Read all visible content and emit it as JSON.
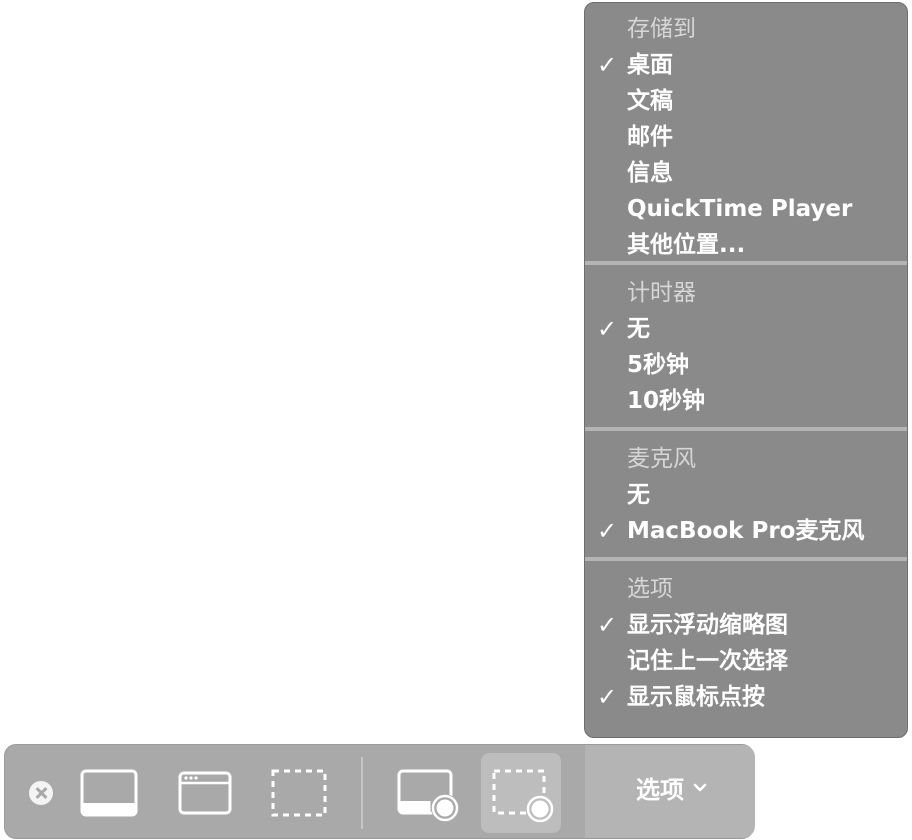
{
  "menu": {
    "sections": [
      {
        "header": "存储到",
        "items": [
          {
            "label": "桌面",
            "checked": true
          },
          {
            "label": "文稿",
            "checked": false
          },
          {
            "label": "邮件",
            "checked": false
          },
          {
            "label": "信息",
            "checked": false
          },
          {
            "label": "QuickTime Player",
            "checked": false
          },
          {
            "label": "其他位置...",
            "checked": false
          }
        ]
      },
      {
        "header": "计时器",
        "items": [
          {
            "label": "无",
            "checked": true
          },
          {
            "label": "5秒钟",
            "checked": false
          },
          {
            "label": "10秒钟",
            "checked": false
          }
        ]
      },
      {
        "header": "麦克风",
        "items": [
          {
            "label": "无",
            "checked": false
          },
          {
            "label": "MacBook Pro麦克风",
            "checked": true
          }
        ]
      },
      {
        "header": "选项",
        "items": [
          {
            "label": "显示浮动缩略图",
            "checked": true
          },
          {
            "label": "记住上一次选择",
            "checked": false
          },
          {
            "label": "显示鼠标点按",
            "checked": true
          }
        ]
      }
    ],
    "check_glyph": "✓"
  },
  "toolbar": {
    "options_label": "选项",
    "buttons": [
      {
        "icon": "capture-entire-screen-icon"
      },
      {
        "icon": "capture-window-icon"
      },
      {
        "icon": "capture-selection-icon"
      },
      {
        "icon": "record-entire-screen-icon"
      },
      {
        "icon": "record-selection-icon",
        "selected": true
      }
    ]
  },
  "colors": {
    "menu_bg": "#8a8a8a",
    "toolbar_bg": "#a9a9a9",
    "selected_button_bg": "#bdbdbd"
  }
}
